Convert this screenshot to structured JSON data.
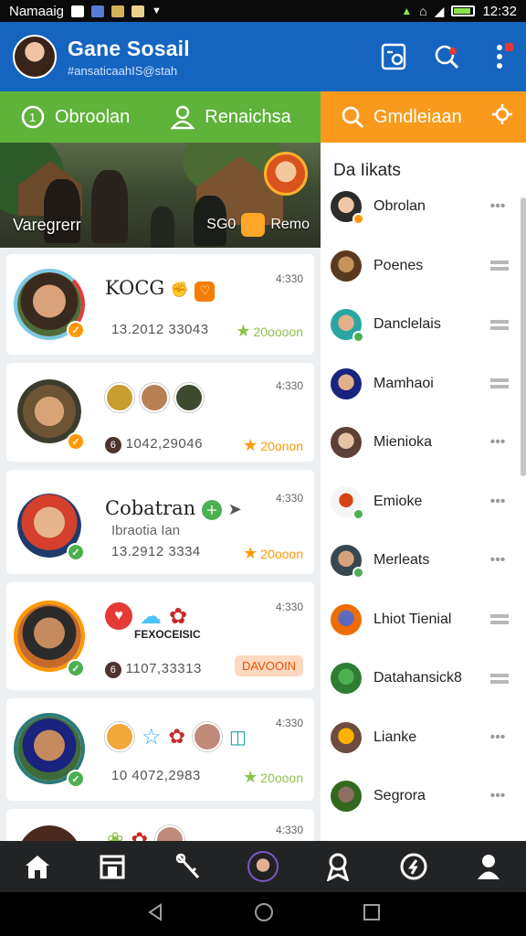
{
  "status_bar": {
    "carrier": "Namaaig",
    "time": "12:32"
  },
  "header": {
    "title": "Gane Sosail",
    "subtitle": "#ansaticaahIS@stah"
  },
  "tabs": [
    {
      "label": "Obroolan",
      "icon": "chat-icon"
    },
    {
      "label": "Renaichsa",
      "icon": "people-icon"
    },
    {
      "label": "Gmdleiaan",
      "icon": "search-icon"
    }
  ],
  "banner": {
    "title": "Varegrerr",
    "score": "SG0",
    "label": "Remo"
  },
  "feed": [
    {
      "name": "KOCG",
      "subtitle": "",
      "time": "4:330",
      "stats": "13.2012 33043",
      "reward": "20oooon",
      "star_color": "#8bc34a",
      "ring_color": "#7ec8e3",
      "mark_color": "#ff9800"
    },
    {
      "name": "",
      "subtitle": "",
      "time": "4:330",
      "stats": "1042,29046",
      "reward": "20onon",
      "star_color": "#ff9800",
      "ring_color": "#ffffff",
      "mark_color": "#ff9800"
    },
    {
      "name": "Cobatran",
      "subtitle": "Ibraotia Ian",
      "time": "4:330",
      "stats": "13.2912 3334",
      "reward": "20ooon",
      "star_color": "#ff9800",
      "ring_color": "#ffffff",
      "mark_color": "#4caf50"
    },
    {
      "name": "",
      "subtitle": "",
      "time": "4:330",
      "stats": "1107,33313",
      "reward": "DAVOOIN",
      "star_color": "#ff9800",
      "ring_color": "#ff9800",
      "mark_color": "#4caf50"
    },
    {
      "name": "",
      "subtitle": "",
      "time": "4:330",
      "stats": "10 4072,2983",
      "reward": "20ooon",
      "star_color": "#8bc34a",
      "ring_color": "#2b7a78",
      "mark_color": "#4caf50"
    },
    {
      "name": "",
      "subtitle": "",
      "time": "4:330",
      "stats": "",
      "reward": "",
      "star_color": "#ff9800",
      "ring_color": "#ffffff",
      "mark_color": "#4caf50"
    }
  ],
  "card1_title_extra": "FEXOCEISIC",
  "sidebar": {
    "title": "Da Iikats",
    "contacts": [
      {
        "name": "Obrolan",
        "control": "dots"
      },
      {
        "name": "Poenes",
        "control": "bars"
      },
      {
        "name": "Danclelais",
        "control": "bars"
      },
      {
        "name": "Mamhaoi",
        "control": "bars"
      },
      {
        "name": "Mienioka",
        "control": "dots"
      },
      {
        "name": "Emioke",
        "control": "dots"
      },
      {
        "name": "Merleats",
        "control": "dots"
      },
      {
        "name": "Lhiot Tienial",
        "control": "bars"
      },
      {
        "name": "Datahansick8",
        "control": "bars"
      },
      {
        "name": "Lianke",
        "control": "dots"
      },
      {
        "name": "Segrora",
        "control": "dots"
      }
    ]
  },
  "bottom_nav": [
    "home-icon",
    "store-icon",
    "tools-icon",
    "profile-avatar",
    "award-icon",
    "compass-icon",
    "user-icon"
  ],
  "colors": {
    "primary": "#1565c0",
    "green_tab": "#5fb23a",
    "orange_tab": "#fa9a1c"
  }
}
